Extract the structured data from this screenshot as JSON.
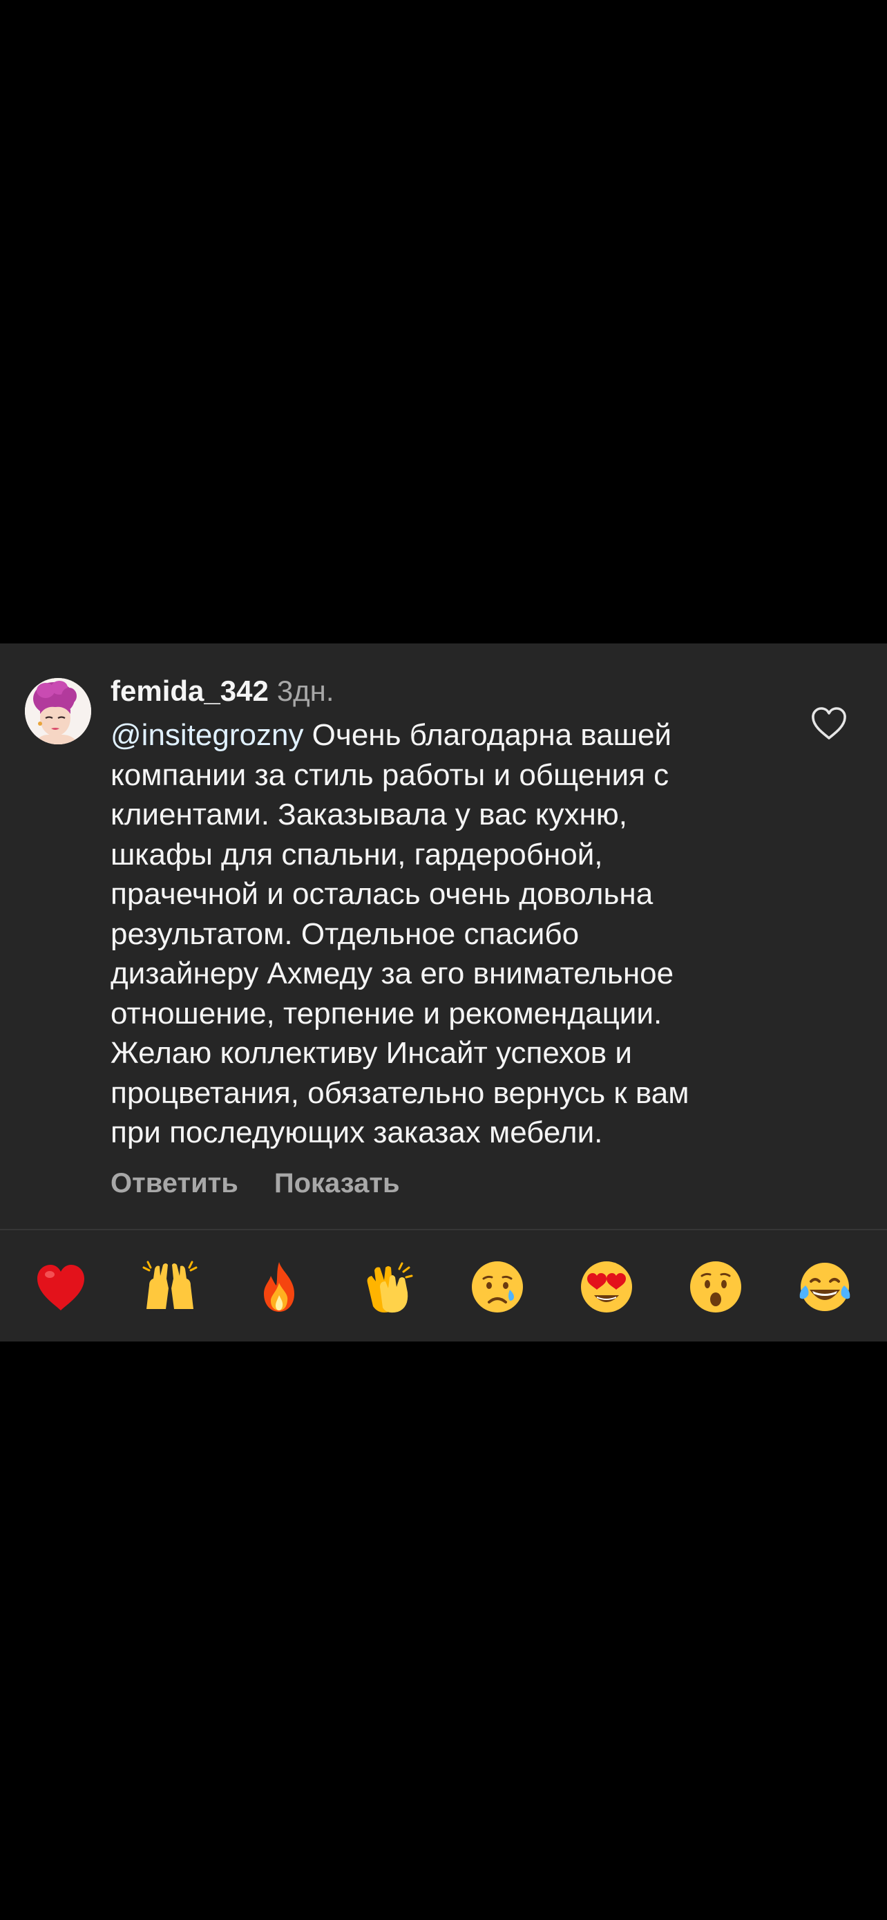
{
  "comment": {
    "username": "femida_342",
    "time": "3дн.",
    "mention": "@insitegrozny",
    "text": " Очень благодарна вашей\nкомпании за стиль работы и общения с\nклиентами. Заказывала у вас кухню,\nшкафы для спальни, гардеробной,\nпрачечной и осталась очень довольна\nрезультатом. Отдельное спасибо\nдизайнеру Ахмеду за его внимательное\nотношение, терпение и рекомендации.\nЖелаю коллективу Инсайт успехов и\nпроцветания, обязательно вернусь к вам\nпри последующих заказах мебели.",
    "reply_label": "Ответить",
    "show_label": "Показать",
    "like_icon": "heart-outline-icon",
    "avatar_icon": "illustrated-woman-avatar"
  },
  "emoji_bar": [
    {
      "name": "red-heart-emoji",
      "glyph": "❤️"
    },
    {
      "name": "raising-hands-emoji",
      "glyph": "🙌"
    },
    {
      "name": "fire-emoji",
      "glyph": "🔥"
    },
    {
      "name": "clapping-hands-emoji",
      "glyph": "👏"
    },
    {
      "name": "crying-face-emoji",
      "glyph": "😢"
    },
    {
      "name": "heart-eyes-emoji",
      "glyph": "😍"
    },
    {
      "name": "surprised-face-emoji",
      "glyph": "😮"
    },
    {
      "name": "tears-of-joy-emoji",
      "glyph": "😂"
    }
  ],
  "colors": {
    "background": "#000000",
    "sheet": "#262626",
    "text_primary": "#f5f5f5",
    "text_secondary": "#a8a8a8",
    "mention": "#e0f1ff",
    "divider": "#363636"
  }
}
